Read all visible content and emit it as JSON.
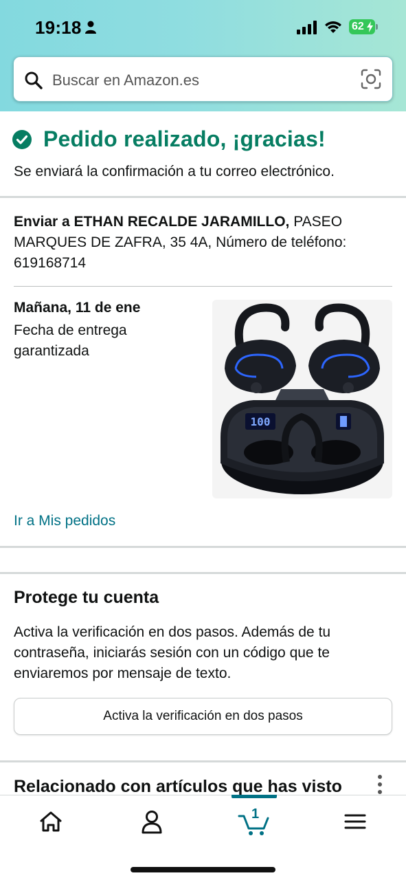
{
  "status_bar": {
    "time": "19:18",
    "battery": "62"
  },
  "search": {
    "placeholder": "Buscar en Amazon.es"
  },
  "order": {
    "title": "Pedido realizado, ¡gracias!",
    "subtitle": "Se enviará la confirmación a tu correo electrónico."
  },
  "shipping": {
    "prefix": "Enviar a ETHAN RECALDE JARAMILLO,",
    "address": " PASEO MARQUES DE ZAFRA, 35 4A, Número de teléfono: 619168714"
  },
  "delivery": {
    "date": "Mañana, 11 de ene",
    "note": "Fecha de entrega garantizada",
    "product_icon": "wireless-earbuds-image"
  },
  "orders_link": "Ir a Mis pedidos",
  "security": {
    "title": "Protege tu cuenta",
    "body": "Activa la verificación en dos pasos. Además de tu contraseña, iniciarás sesión con un código que te enviaremos por mensaje de texto.",
    "button_label": "Activa la verificación en dos pasos"
  },
  "related": {
    "title": "Relacionado con artículos que has visto"
  },
  "tab_bar": {
    "items": [
      {
        "name": "home",
        "icon": "home-icon"
      },
      {
        "name": "account",
        "icon": "person-icon"
      },
      {
        "name": "cart",
        "icon": "cart-icon",
        "badge": "1",
        "active": true
      },
      {
        "name": "menu",
        "icon": "hamburger-menu-icon"
      }
    ]
  },
  "colors": {
    "success": "#067d62",
    "link": "#007185",
    "accent": "#007185"
  }
}
